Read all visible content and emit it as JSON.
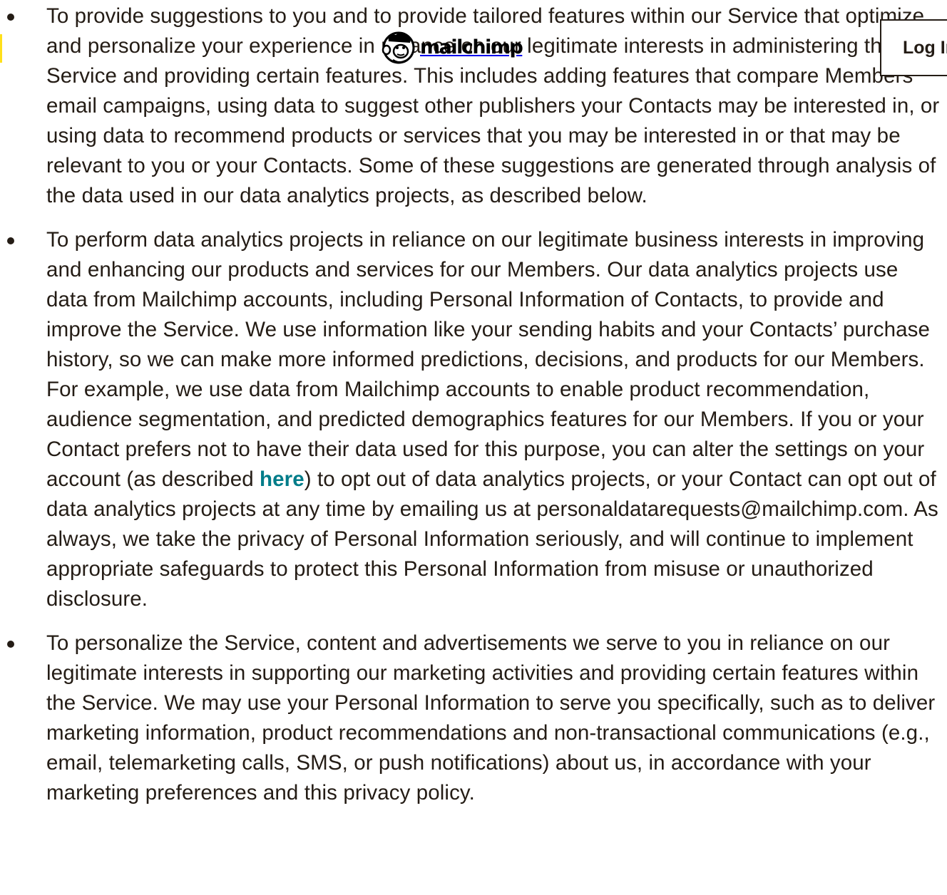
{
  "header": {
    "logo_text": "mailchimp",
    "login_label": "Log In",
    "colors": {
      "brand_yellow": "#ffe01b",
      "link_teal": "#007c89",
      "text": "#241c15"
    }
  },
  "policy": {
    "items": [
      {
        "text": "To provide suggestions to you and to provide tailored features within our Service that optimize and personalize your experience in reliance on our legitimate interests in administering the Service and providing certain features. This includes adding features that compare Members’ email campaigns, using data to suggest other publishers your Contacts may be interested in, or using data to recommend products or services that you may be interested in or that may be relevant to you or your Contacts. Some of these suggestions are generated through analysis of the data used in our data analytics projects, as described below."
      },
      {
        "text_before_link": "To perform data analytics projects in reliance on our legitimate business interests in improving and enhancing our products and services for our Members. Our data analytics projects use data from Mailchimp accounts, including Personal Information of Contacts, to provide and improve the Service. We use information like your sending habits and your Contacts’ purchase history, so we can make more informed predictions, decisions, and products for our Members. For example, we use data from Mailchimp accounts to enable product recommendation, audience segmentation, and predicted demographics features for our Members. If you or your Contact prefers not to have their data used for this purpose, you can alter the settings on your account (as described ",
        "link_text": "here",
        "text_after_link": ") to opt out of data analytics projects, or your Contact can opt out of data analytics projects at any time by emailing us at personaldatarequests@mailchimp.com. As always, we take the privacy of Personal Information seriously, and will continue to implement appropriate safeguards to protect this Personal Information from misuse or unauthorized disclosure."
      },
      {
        "text": "To personalize the Service, content and advertisements we serve to you in reliance on our legitimate interests in supporting our marketing activities and providing certain features within the Service. We may use your Personal Information to serve you specifically, such as to deliver marketing information, product recommendations and non-transactional communications (e.g., email, telemarketing calls, SMS, or push notifications) about us, in accordance with your marketing preferences and this privacy policy."
      }
    ]
  }
}
